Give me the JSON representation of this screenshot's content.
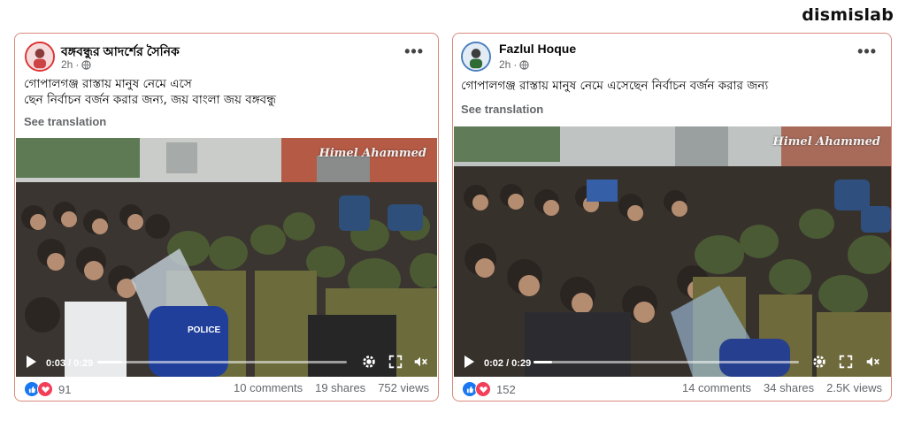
{
  "brand": "dismislab",
  "posts": [
    {
      "author": "বঙ্গবন্ধুর আদর্শের সৈনিক",
      "time": "2h",
      "text_line1": "গোপালগঞ্জ রাস্তায় মানুষ  নেমে এসে",
      "text_line2": "ছেন  নির্বাচন বর্জন করার জন্য, জয় বাংলা জয় বঙ্গবন্ধু",
      "see_translation": "See translation",
      "watermark": "Himel Ahammed",
      "video_time": "0:03 / 0:29",
      "video_progress": 0.1,
      "police_text": "POLICE",
      "reaction_count": "91",
      "comments": "10 comments",
      "shares": "19 shares",
      "views": "752 views"
    },
    {
      "author": "Fazlul Hoque",
      "time": "2h",
      "text_line1": "গোপালগঞ্জ রাস্তায় মানুষ  নেমে এসেছেন  নির্বাচন বর্জন করার জন্য",
      "see_translation": "See translation",
      "watermark": "Himel Ahammed",
      "video_time": "0:02 / 0:29",
      "video_progress": 0.07,
      "reaction_count": "152",
      "comments": "14 comments",
      "shares": "34 shares",
      "views": "2.5K views"
    }
  ],
  "colors": {
    "like": "#1877f2",
    "love": "#f33e58",
    "card_border": "#d98a7c"
  },
  "icons": [
    "globe-icon",
    "more-icon",
    "play-icon",
    "settings-icon",
    "fullscreen-icon",
    "volume-icon",
    "like-icon",
    "love-icon"
  ]
}
